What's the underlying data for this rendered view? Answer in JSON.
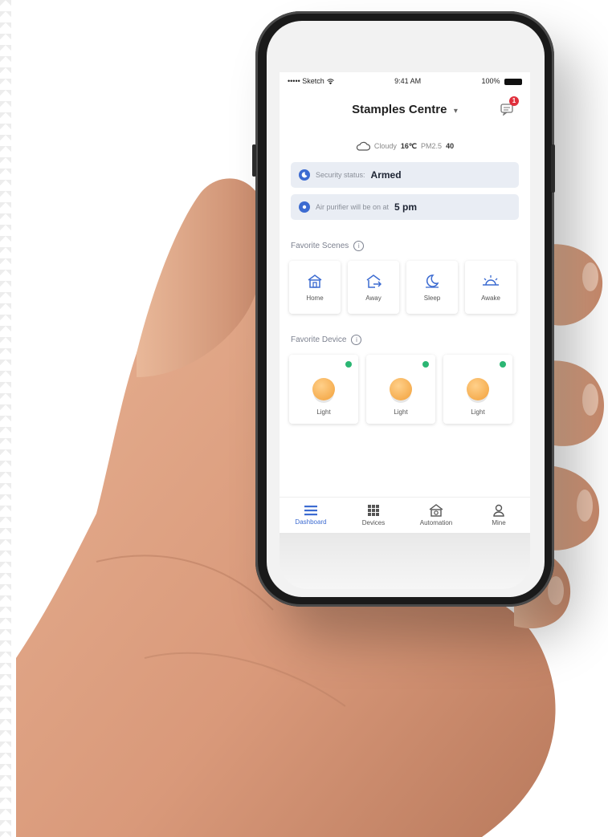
{
  "status_bar": {
    "carrier": "••••• Sketch",
    "time": "9:41 AM",
    "battery": "100%"
  },
  "header": {
    "title": "Stamples Centre",
    "caret": "▾",
    "message_badge": "1"
  },
  "weather": {
    "condition": "Cloudy",
    "temperature": "16℃",
    "pm_label": "PM2.5",
    "pm_value": "40"
  },
  "security": {
    "label": "Security status:",
    "value": "Armed"
  },
  "purifier": {
    "label": "Air purifier will be on at",
    "value": "5 pm"
  },
  "favorite_scenes": {
    "title": "Favorite Scenes",
    "items": [
      {
        "label": "Home",
        "icon": "home-icon"
      },
      {
        "label": "Away",
        "icon": "away-icon"
      },
      {
        "label": "Sleep",
        "icon": "sleep-icon"
      },
      {
        "label": "Awake",
        "icon": "sunrise-icon"
      }
    ]
  },
  "favorite_devices": {
    "title": "Favorite Device",
    "items": [
      {
        "label": "Light",
        "status": "on"
      },
      {
        "label": "Light",
        "status": "on"
      },
      {
        "label": "Light",
        "status": "on"
      }
    ]
  },
  "tabbar": {
    "items": [
      {
        "label": "Dashboard",
        "icon": "menu-icon",
        "active": true
      },
      {
        "label": "Devices",
        "icon": "grid-icon",
        "active": false
      },
      {
        "label": "Automation",
        "icon": "automation-icon",
        "active": false
      },
      {
        "label": "Mine",
        "icon": "user-icon",
        "active": false
      }
    ]
  },
  "colors": {
    "accent": "#3c6bd1",
    "badge": "#e0303d",
    "online": "#2bb673",
    "bulb": "#f2a03a"
  }
}
